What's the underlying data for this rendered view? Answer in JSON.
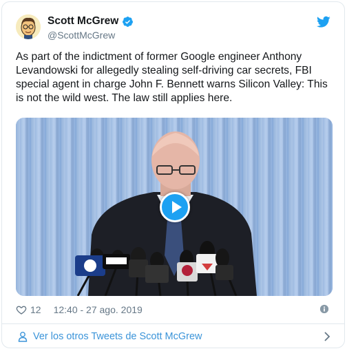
{
  "tweet": {
    "author": {
      "display_name": "Scott McGrew",
      "handle": "@ScottMcGrew",
      "verified": true
    },
    "text": "As part of the indictment of former Google engineer Anthony Levandowski for allegedly stealing self-driving car secrets, FBI special agent in charge John F. Bennett warns Silicon Valley: This is not the wild west.  The law still applies here.",
    "likes": "12",
    "timestamp": "12:40 - 27 ago. 2019",
    "media": {
      "type": "video",
      "play_icon": "play-icon"
    }
  },
  "footer": {
    "more_tweets_label": "Ver los otros Tweets de Scott McGrew"
  },
  "icons": {
    "verified": "verified-badge-icon",
    "twitter": "twitter-bird-icon",
    "like": "heart-icon",
    "info": "info-icon",
    "user": "user-icon",
    "chevron": "chevron-right-icon"
  },
  "colors": {
    "accent": "#1da1f2",
    "link": "#3b94d9",
    "secondary_text": "#657786",
    "border": "#e1e8ed"
  }
}
